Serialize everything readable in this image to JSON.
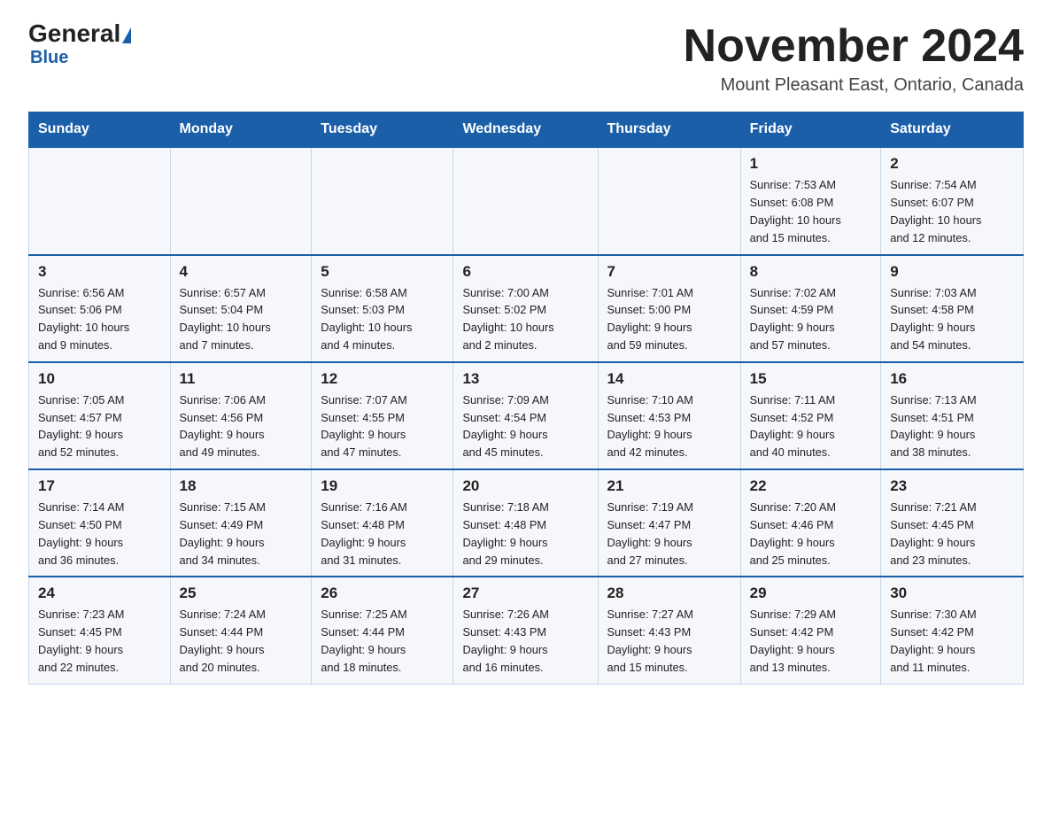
{
  "logo": {
    "general": "General",
    "triangle": "",
    "blue": "Blue"
  },
  "title": "November 2024",
  "location": "Mount Pleasant East, Ontario, Canada",
  "days_of_week": [
    "Sunday",
    "Monday",
    "Tuesday",
    "Wednesday",
    "Thursday",
    "Friday",
    "Saturday"
  ],
  "weeks": [
    [
      {
        "day": "",
        "info": ""
      },
      {
        "day": "",
        "info": ""
      },
      {
        "day": "",
        "info": ""
      },
      {
        "day": "",
        "info": ""
      },
      {
        "day": "",
        "info": ""
      },
      {
        "day": "1",
        "info": "Sunrise: 7:53 AM\nSunset: 6:08 PM\nDaylight: 10 hours\nand 15 minutes."
      },
      {
        "day": "2",
        "info": "Sunrise: 7:54 AM\nSunset: 6:07 PM\nDaylight: 10 hours\nand 12 minutes."
      }
    ],
    [
      {
        "day": "3",
        "info": "Sunrise: 6:56 AM\nSunset: 5:06 PM\nDaylight: 10 hours\nand 9 minutes."
      },
      {
        "day": "4",
        "info": "Sunrise: 6:57 AM\nSunset: 5:04 PM\nDaylight: 10 hours\nand 7 minutes."
      },
      {
        "day": "5",
        "info": "Sunrise: 6:58 AM\nSunset: 5:03 PM\nDaylight: 10 hours\nand 4 minutes."
      },
      {
        "day": "6",
        "info": "Sunrise: 7:00 AM\nSunset: 5:02 PM\nDaylight: 10 hours\nand 2 minutes."
      },
      {
        "day": "7",
        "info": "Sunrise: 7:01 AM\nSunset: 5:00 PM\nDaylight: 9 hours\nand 59 minutes."
      },
      {
        "day": "8",
        "info": "Sunrise: 7:02 AM\nSunset: 4:59 PM\nDaylight: 9 hours\nand 57 minutes."
      },
      {
        "day": "9",
        "info": "Sunrise: 7:03 AM\nSunset: 4:58 PM\nDaylight: 9 hours\nand 54 minutes."
      }
    ],
    [
      {
        "day": "10",
        "info": "Sunrise: 7:05 AM\nSunset: 4:57 PM\nDaylight: 9 hours\nand 52 minutes."
      },
      {
        "day": "11",
        "info": "Sunrise: 7:06 AM\nSunset: 4:56 PM\nDaylight: 9 hours\nand 49 minutes."
      },
      {
        "day": "12",
        "info": "Sunrise: 7:07 AM\nSunset: 4:55 PM\nDaylight: 9 hours\nand 47 minutes."
      },
      {
        "day": "13",
        "info": "Sunrise: 7:09 AM\nSunset: 4:54 PM\nDaylight: 9 hours\nand 45 minutes."
      },
      {
        "day": "14",
        "info": "Sunrise: 7:10 AM\nSunset: 4:53 PM\nDaylight: 9 hours\nand 42 minutes."
      },
      {
        "day": "15",
        "info": "Sunrise: 7:11 AM\nSunset: 4:52 PM\nDaylight: 9 hours\nand 40 minutes."
      },
      {
        "day": "16",
        "info": "Sunrise: 7:13 AM\nSunset: 4:51 PM\nDaylight: 9 hours\nand 38 minutes."
      }
    ],
    [
      {
        "day": "17",
        "info": "Sunrise: 7:14 AM\nSunset: 4:50 PM\nDaylight: 9 hours\nand 36 minutes."
      },
      {
        "day": "18",
        "info": "Sunrise: 7:15 AM\nSunset: 4:49 PM\nDaylight: 9 hours\nand 34 minutes."
      },
      {
        "day": "19",
        "info": "Sunrise: 7:16 AM\nSunset: 4:48 PM\nDaylight: 9 hours\nand 31 minutes."
      },
      {
        "day": "20",
        "info": "Sunrise: 7:18 AM\nSunset: 4:48 PM\nDaylight: 9 hours\nand 29 minutes."
      },
      {
        "day": "21",
        "info": "Sunrise: 7:19 AM\nSunset: 4:47 PM\nDaylight: 9 hours\nand 27 minutes."
      },
      {
        "day": "22",
        "info": "Sunrise: 7:20 AM\nSunset: 4:46 PM\nDaylight: 9 hours\nand 25 minutes."
      },
      {
        "day": "23",
        "info": "Sunrise: 7:21 AM\nSunset: 4:45 PM\nDaylight: 9 hours\nand 23 minutes."
      }
    ],
    [
      {
        "day": "24",
        "info": "Sunrise: 7:23 AM\nSunset: 4:45 PM\nDaylight: 9 hours\nand 22 minutes."
      },
      {
        "day": "25",
        "info": "Sunrise: 7:24 AM\nSunset: 4:44 PM\nDaylight: 9 hours\nand 20 minutes."
      },
      {
        "day": "26",
        "info": "Sunrise: 7:25 AM\nSunset: 4:44 PM\nDaylight: 9 hours\nand 18 minutes."
      },
      {
        "day": "27",
        "info": "Sunrise: 7:26 AM\nSunset: 4:43 PM\nDaylight: 9 hours\nand 16 minutes."
      },
      {
        "day": "28",
        "info": "Sunrise: 7:27 AM\nSunset: 4:43 PM\nDaylight: 9 hours\nand 15 minutes."
      },
      {
        "day": "29",
        "info": "Sunrise: 7:29 AM\nSunset: 4:42 PM\nDaylight: 9 hours\nand 13 minutes."
      },
      {
        "day": "30",
        "info": "Sunrise: 7:30 AM\nSunset: 4:42 PM\nDaylight: 9 hours\nand 11 minutes."
      }
    ]
  ]
}
